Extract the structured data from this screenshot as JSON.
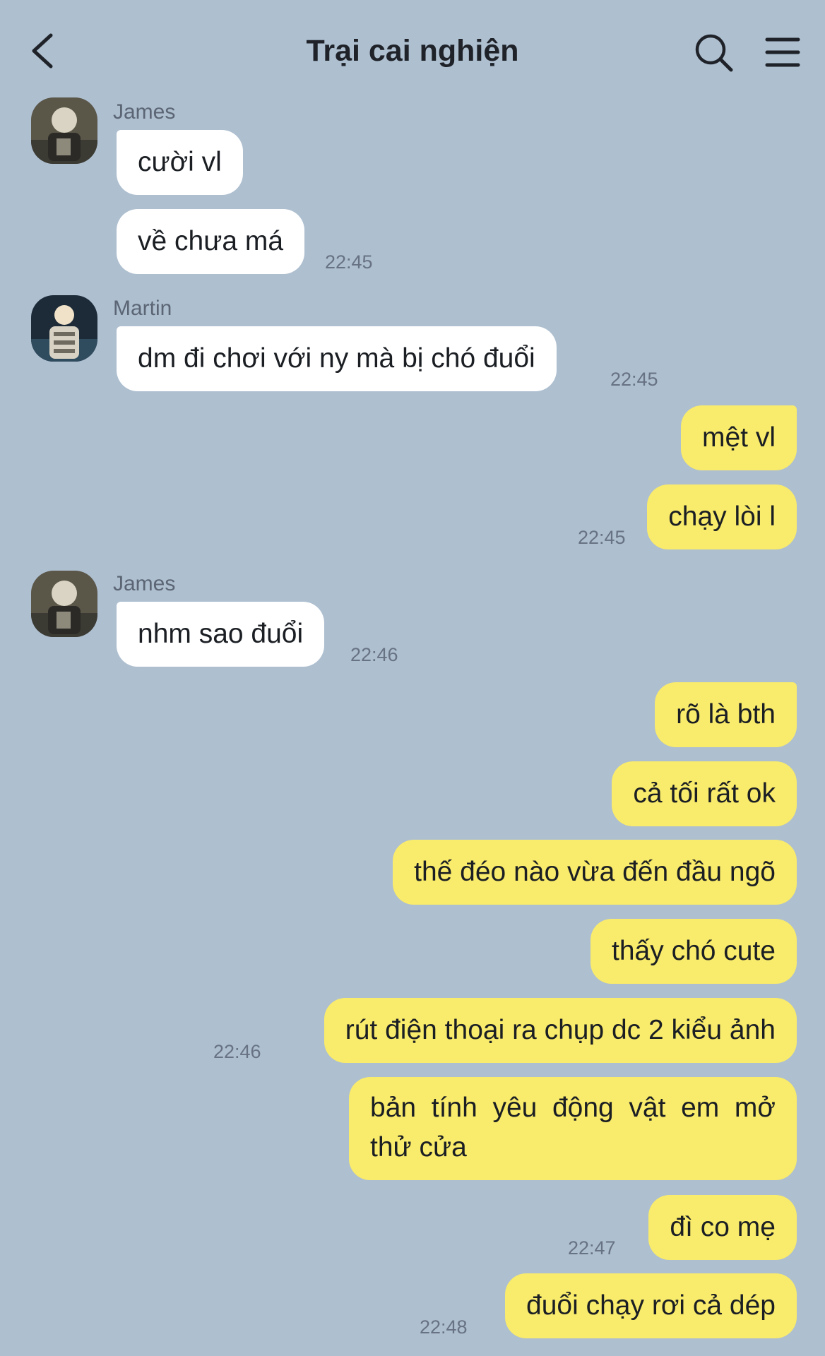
{
  "header": {
    "title": "Trại cai nghiện",
    "back_icon": "chevron-left-icon",
    "search_icon": "search-icon",
    "menu_icon": "hamburger-menu-icon"
  },
  "senders": {
    "james": "James",
    "martin": "Martin"
  },
  "messages": {
    "m1": "cười vl",
    "m2": "về chưa má",
    "m3": "dm đi chơi với ny mà bị chó đuổi",
    "m4": "mệt vl",
    "m5": "chạy lòi l",
    "m6": "nhm sao đuổi",
    "m7": "rõ là bth",
    "m8": "cả tối rất ok",
    "m9": "thế đéo nào vừa đến đầu ngõ",
    "m10": "thấy chó cute",
    "m11": "rút điện thoại ra chụp dc 2 kiểu ảnh",
    "m12": "bản tính yêu động vật em mở thử cửa",
    "m13": "đì co mẹ",
    "m14": "đuổi chạy rơi cả dép"
  },
  "times": {
    "t1": "22:45",
    "t2": "22:45",
    "t3": "22:45",
    "t4": "22:46",
    "t5": "22:46",
    "t6": "22:47",
    "t7": "22:48"
  },
  "colors": {
    "background": "#aebfd0",
    "incoming_bubble": "#ffffff",
    "outgoing_bubble": "#f9eb6b"
  }
}
